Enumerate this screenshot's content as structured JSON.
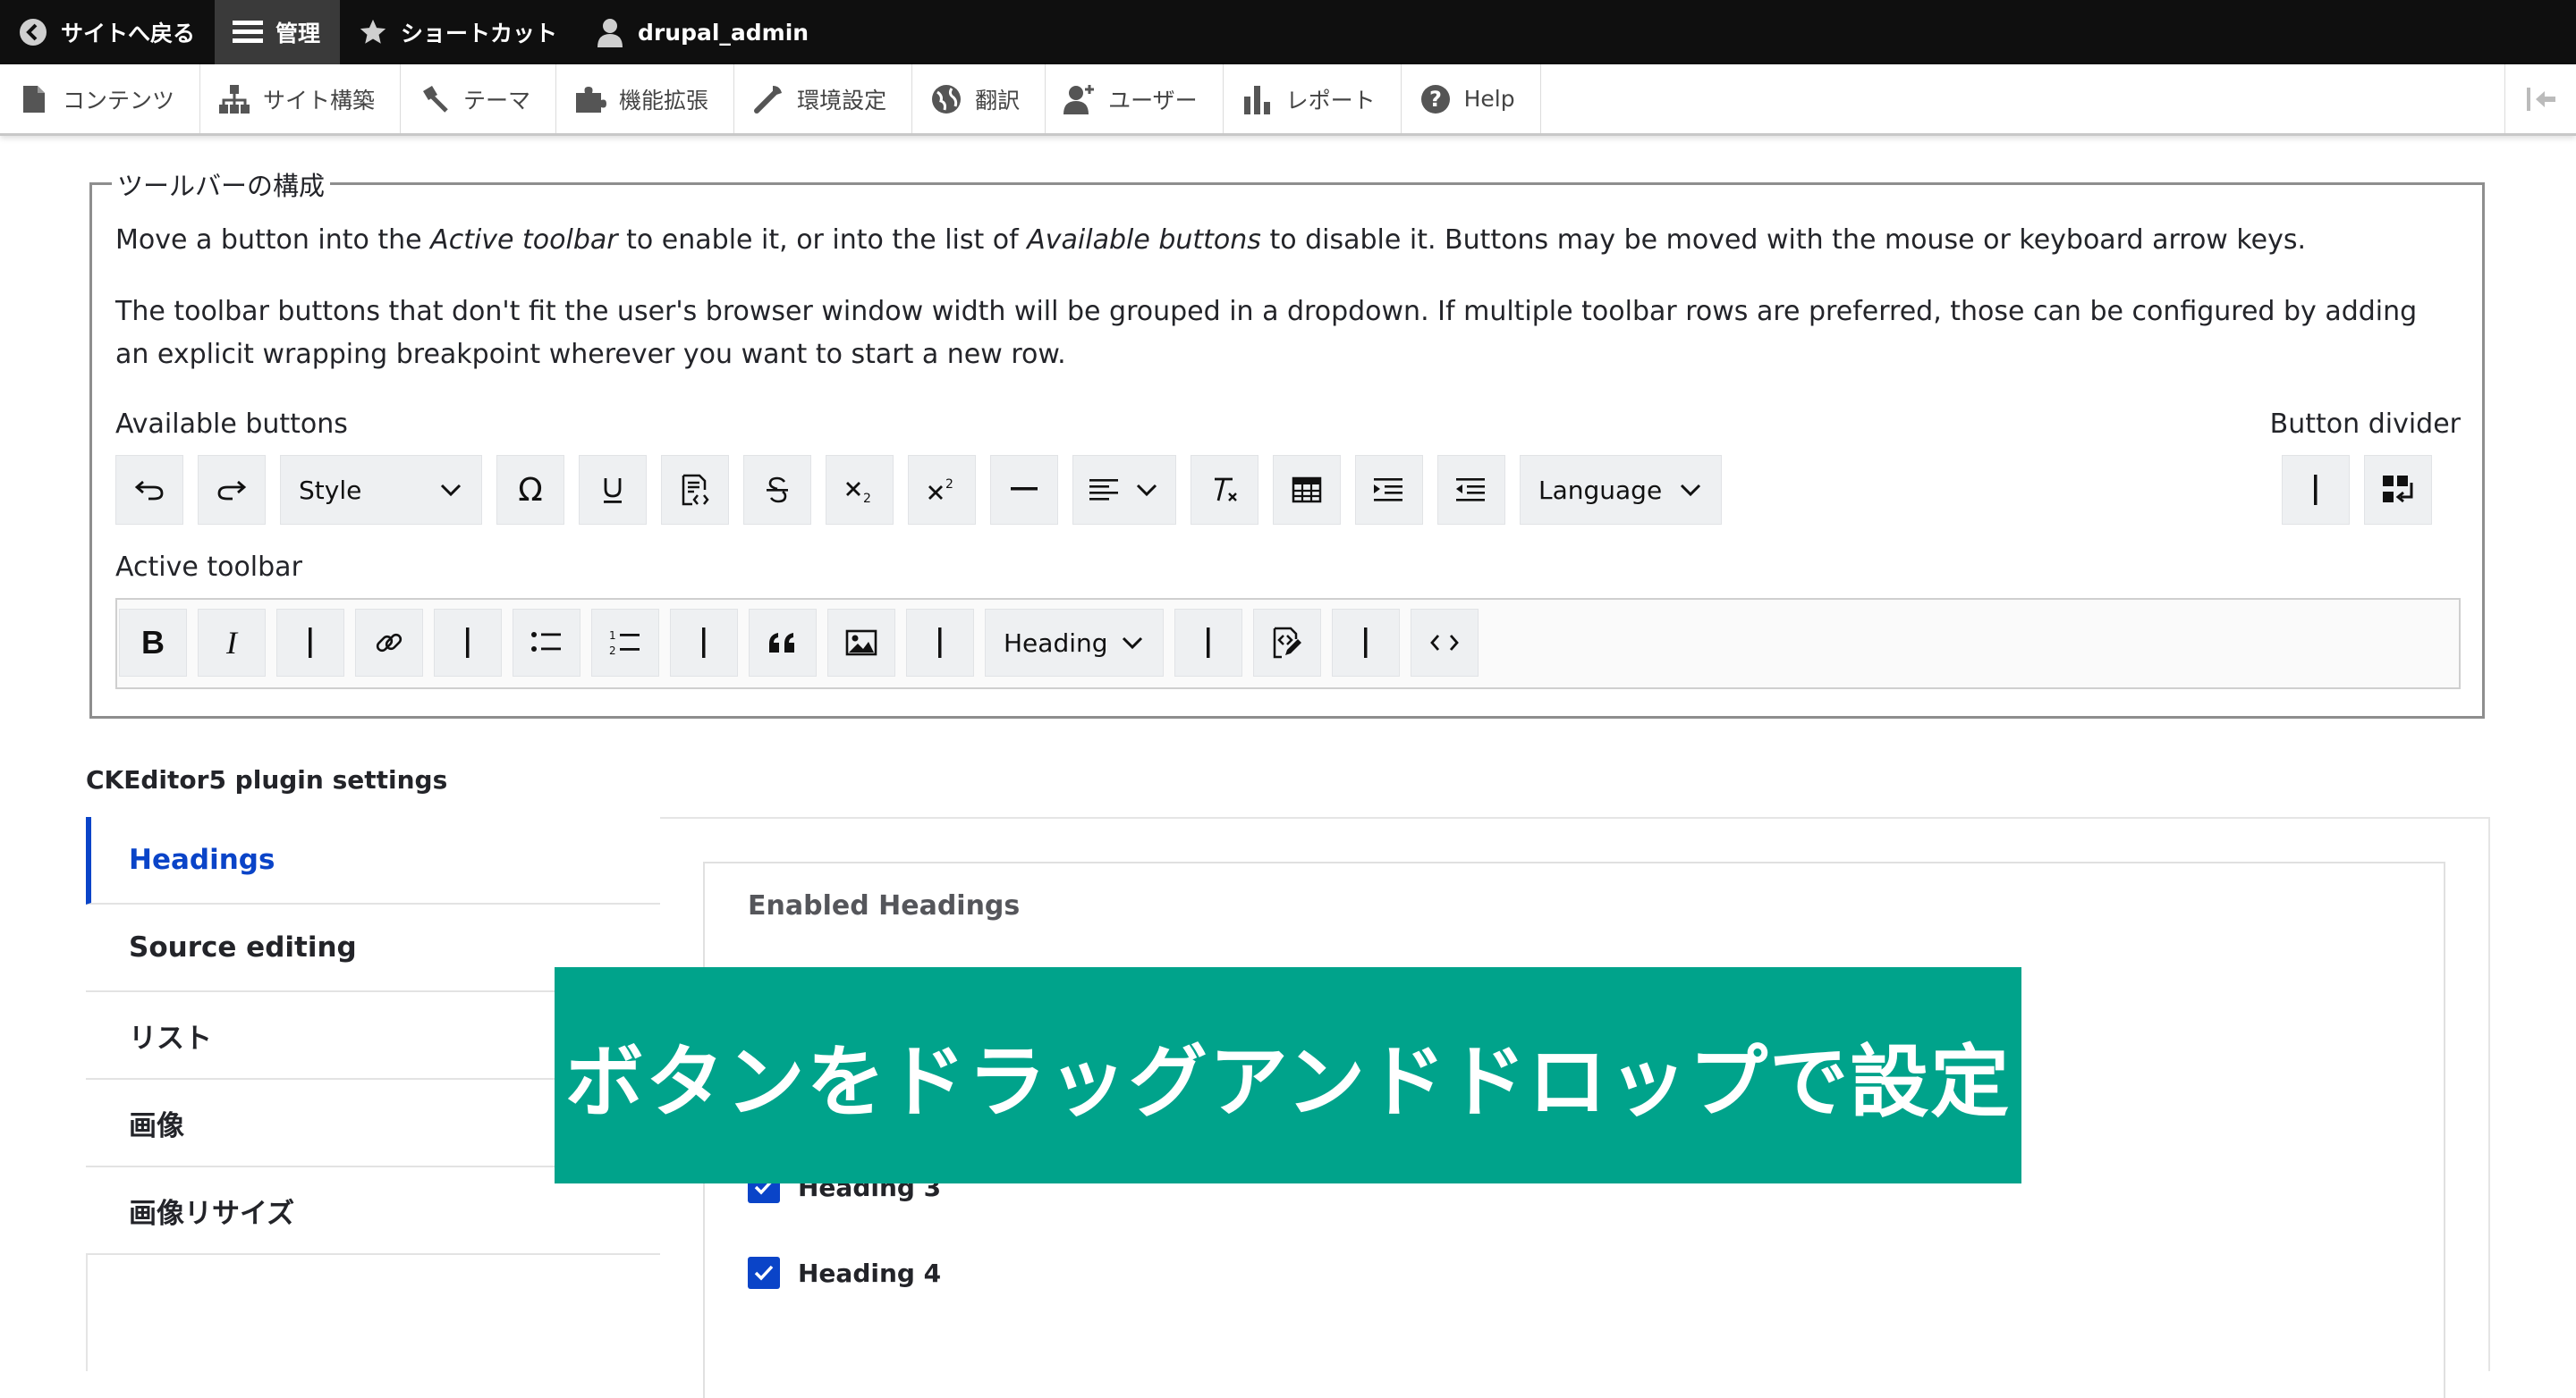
{
  "topbar": {
    "back": "サイトへ戻る",
    "manage": "管理",
    "shortcuts": "ショートカット",
    "user": "drupal_admin"
  },
  "tray": {
    "items": [
      "コンテンツ",
      "サイト構築",
      "テーマ",
      "機能拡張",
      "環境設定",
      "翻訳",
      "ユーザー",
      "レポート",
      "Help"
    ]
  },
  "fieldset": {
    "legend": "ツールバーの構成",
    "desc1_a": "Move a button into the ",
    "desc1_b": "Active toolbar",
    "desc1_c": " to enable it, or into the list of ",
    "desc1_d": "Available buttons",
    "desc1_e": " to disable it. Buttons may be moved with the mouse or keyboard arrow keys.",
    "desc2": "The toolbar buttons that don't fit the user's browser window width will be grouped in a dropdown. If multiple toolbar rows are preferred, those can be configured by adding an explicit wrapping breakpoint wherever you want to start a new row.",
    "available_label": "Available buttons",
    "divider_label": "Button divider",
    "active_label": "Active toolbar",
    "style_label": "Style",
    "language_label": "Language",
    "heading_label": "Heading",
    "omega": "Ω"
  },
  "plugin": {
    "title": "CKEditor5 plugin settings",
    "tabs": [
      "Headings",
      "Source editing",
      "リスト",
      "画像",
      "画像リサイズ"
    ],
    "panel_title": "Enabled Headings",
    "headings": [
      "Heading 3",
      "Heading 4"
    ]
  },
  "banner": {
    "text": "ボタンをドラッグアンドドロップで設定"
  },
  "colors": {
    "accent": "#0a44c8",
    "banner": "#00a38b",
    "topbar": "#0f0f0f"
  }
}
